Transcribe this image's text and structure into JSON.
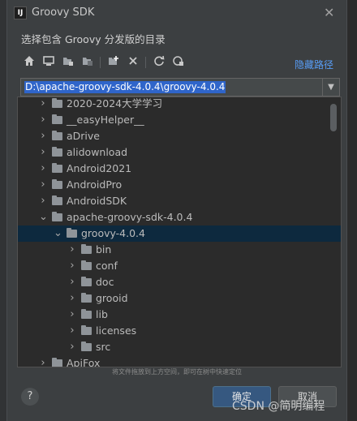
{
  "window": {
    "title": "Groovy SDK",
    "app_icon_text": "IJ"
  },
  "subtitle": "选择包含 Groovy 分发版的目录",
  "toolbar": {
    "icons": [
      "home-icon",
      "desktop-icon",
      "project-icon",
      "module-icon",
      "new-folder-icon",
      "delete-icon",
      "refresh-icon",
      "show-hidden-icon"
    ],
    "hide_path_label": "隐藏路径"
  },
  "path_field": {
    "value": "D:\\apache-groovy-sdk-4.0.4\\groovy-4.0.4"
  },
  "tree": {
    "items": [
      {
        "label": "2020-2024大学学习",
        "level": 0,
        "expanded": false,
        "selected": false
      },
      {
        "label": "__easyHelper__",
        "level": 0,
        "expanded": false,
        "selected": false
      },
      {
        "label": "aDrive",
        "level": 0,
        "expanded": false,
        "selected": false
      },
      {
        "label": "alidownload",
        "level": 0,
        "expanded": false,
        "selected": false
      },
      {
        "label": "Android2021",
        "level": 0,
        "expanded": false,
        "selected": false
      },
      {
        "label": "AndroidPro",
        "level": 0,
        "expanded": false,
        "selected": false
      },
      {
        "label": "AndroidSDK",
        "level": 0,
        "expanded": false,
        "selected": false
      },
      {
        "label": "apache-groovy-sdk-4.0.4",
        "level": 0,
        "expanded": true,
        "selected": false
      },
      {
        "label": "groovy-4.0.4",
        "level": 1,
        "expanded": true,
        "selected": true
      },
      {
        "label": "bin",
        "level": 2,
        "expanded": false,
        "selected": false
      },
      {
        "label": "conf",
        "level": 2,
        "expanded": false,
        "selected": false
      },
      {
        "label": "doc",
        "level": 2,
        "expanded": false,
        "selected": false
      },
      {
        "label": "grooid",
        "level": 2,
        "expanded": false,
        "selected": false
      },
      {
        "label": "lib",
        "level": 2,
        "expanded": false,
        "selected": false
      },
      {
        "label": "licenses",
        "level": 2,
        "expanded": false,
        "selected": false
      },
      {
        "label": "src",
        "level": 2,
        "expanded": false,
        "selected": false
      },
      {
        "label": "ApiFox",
        "level": 0,
        "expanded": false,
        "selected": false
      }
    ]
  },
  "hint": "将文件拖放到上方空间，即可在树中快速定位",
  "buttons": {
    "help": "?",
    "ok": "确定",
    "cancel": "取消"
  },
  "watermark": "CSDN @简明编程",
  "colors": {
    "accent": "#589df6",
    "selection": "#0d293e",
    "primary_button": "#365880",
    "dialog_bg": "#3c3f41"
  }
}
